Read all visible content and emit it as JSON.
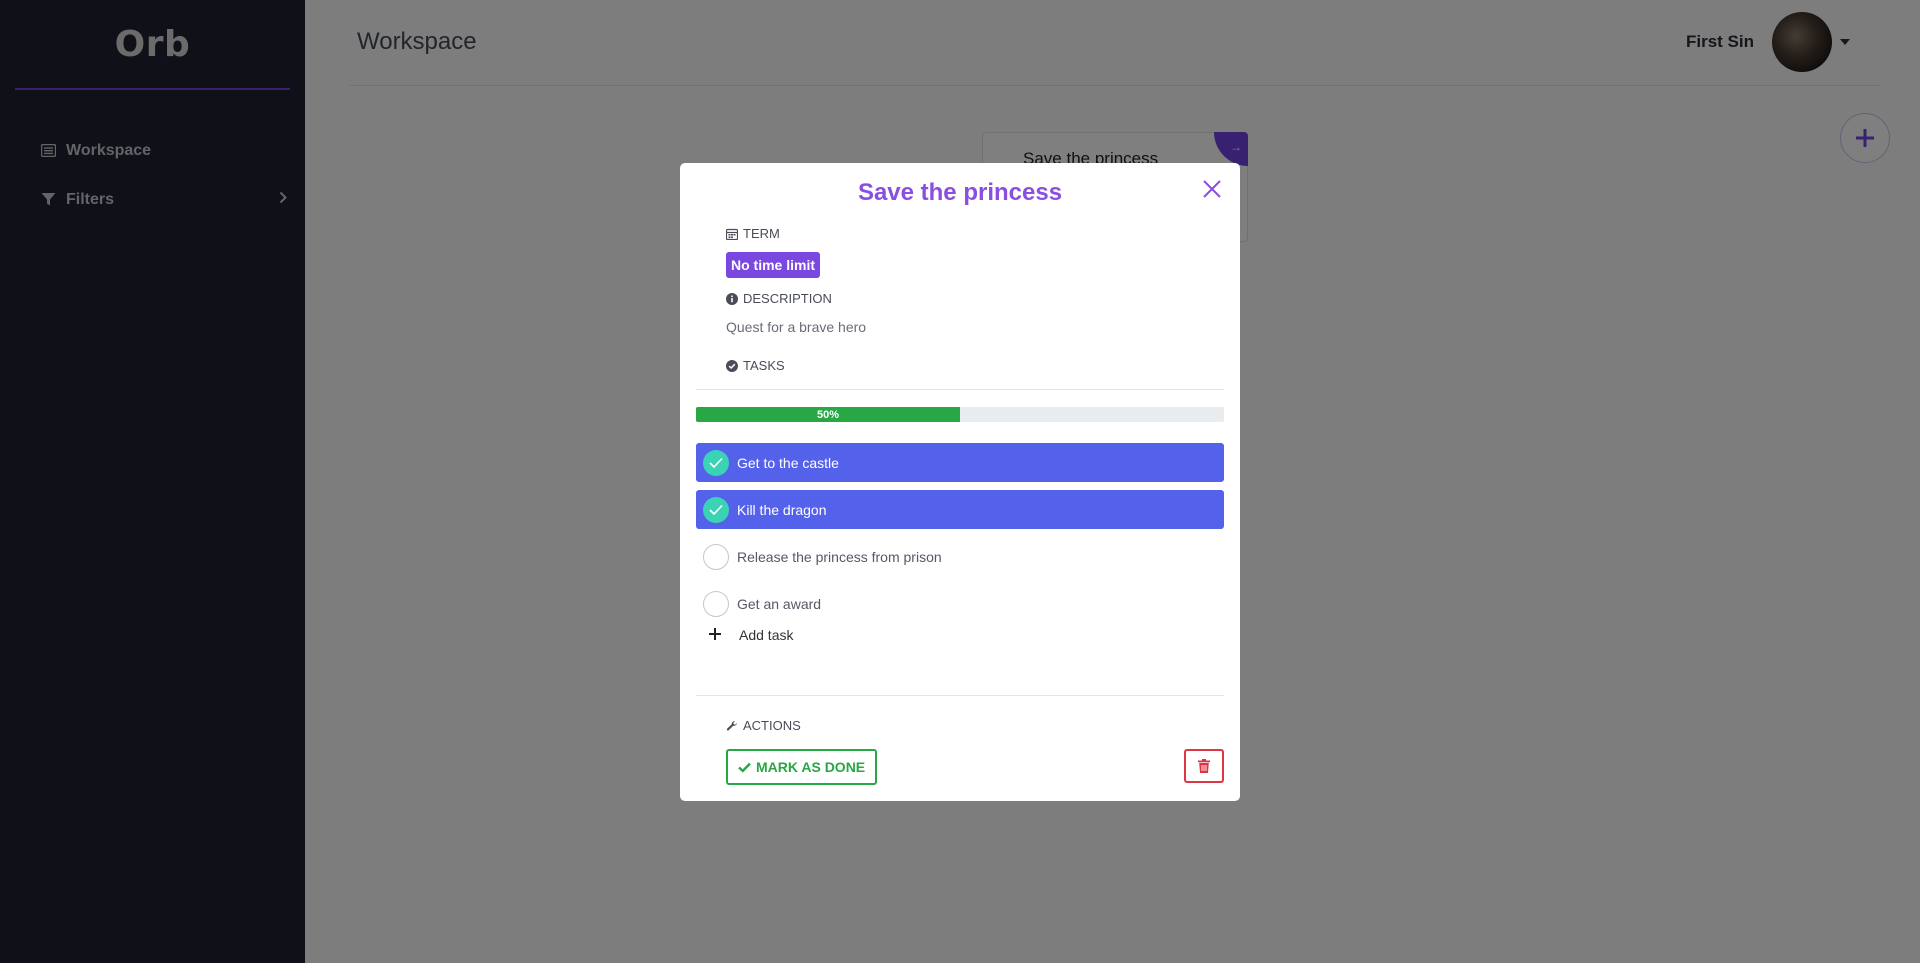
{
  "sidebar": {
    "brand": "Orb",
    "items": [
      {
        "label": "Workspace",
        "icon": "list-icon"
      },
      {
        "label": "Filters",
        "icon": "filter-icon"
      }
    ]
  },
  "header": {
    "title": "Workspace",
    "user_name": "First Sin"
  },
  "background_card": {
    "title": "Save the princess",
    "corner_arrow": "→"
  },
  "modal": {
    "title": "Save the princess",
    "term_label": "TERM",
    "term_value": "No time limit",
    "description_label": "DESCRIPTION",
    "description_text": "Quest for a brave hero",
    "tasks_label": "TASKS",
    "progress": {
      "value": 50,
      "label": "50%"
    },
    "tasks": [
      {
        "label": "Get to the castle",
        "done": true
      },
      {
        "label": "Kill the dragon",
        "done": true
      },
      {
        "label": "Release the princess from prison",
        "done": false
      },
      {
        "label": "Get an award",
        "done": false
      }
    ],
    "add_task_label": "Add task",
    "actions_label": "ACTIONS",
    "mark_done_label": "MARK AS DONE"
  },
  "colors": {
    "sidebar_bg": "#1f2130",
    "accent_purple": "#7a47e0",
    "task_done_bg": "#5461eb",
    "check_teal": "#3bd3b5",
    "success_green": "#28a745",
    "danger_red": "#dc3545"
  }
}
